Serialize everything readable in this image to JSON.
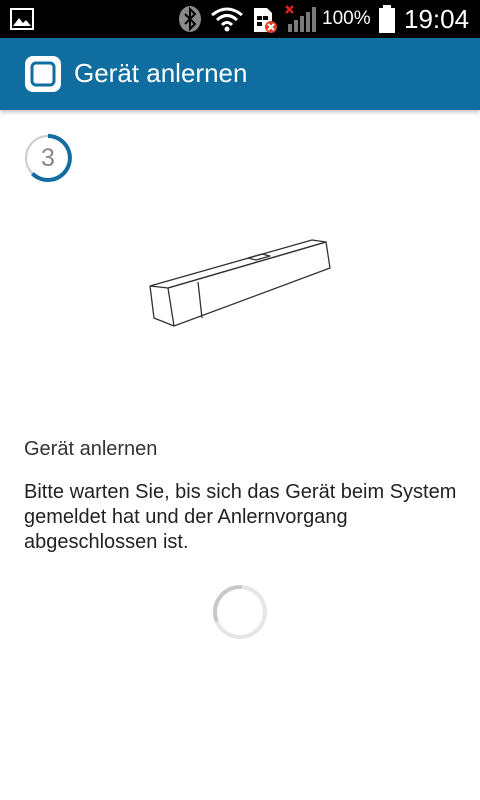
{
  "status_bar": {
    "battery_percent": "100%",
    "time": "19:04",
    "icons": [
      "gallery-icon",
      "bluetooth-icon",
      "wifi-icon",
      "sim-error-icon",
      "no-signal-icon",
      "battery-icon"
    ]
  },
  "app_bar": {
    "title": "Gerät anlernen",
    "icon": "app-logo-icon",
    "color": "#0f6da0"
  },
  "step": {
    "current": "3",
    "accent_color": "#0f6da0"
  },
  "illustration": {
    "icon": "device-bar-illustration"
  },
  "content": {
    "heading": "Gerät anlernen",
    "description": "Bitte warten Sie, bis sich das Gerät beim System gemeldet hat und der Anlernvorgang abgeschlossen ist."
  },
  "loading": {
    "icon": "loading-spinner-icon"
  }
}
